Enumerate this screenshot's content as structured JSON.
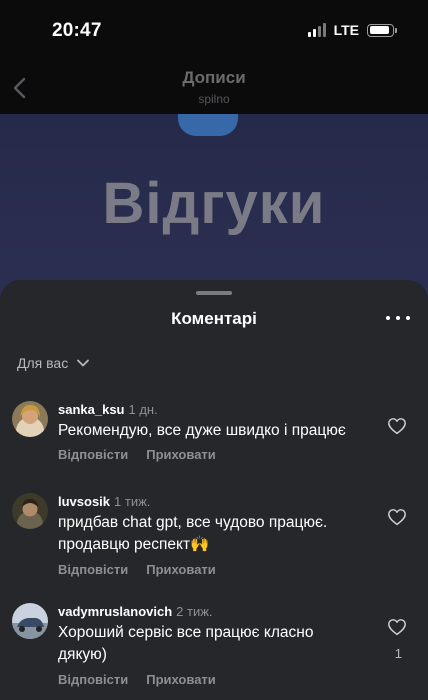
{
  "status_bar": {
    "time": "20:47",
    "network": "LTE",
    "battery_level": 0.9,
    "signal_bars": 2
  },
  "header": {
    "back_icon": "chevron-left-icon",
    "title": "Дописи",
    "subtitle": "spilno"
  },
  "post": {
    "image_text": "Відгуки"
  },
  "sheet": {
    "title": "Коментарі",
    "more_icon": "more-horizontal-icon",
    "filter_label": "Для вас",
    "filter_icon": "chevron-down-icon"
  },
  "comments": [
    {
      "username": "sanka_ksu",
      "time": "1 дн.",
      "text": "Рекомендую, все дуже швидко і працює",
      "reply": "Відповісти",
      "hide": "Приховати",
      "likes": ""
    },
    {
      "username": "luvsosik",
      "time": "1 тиж.",
      "text": "придбав chat gpt, все чудово працює. продавцю респект🙌",
      "reply": "Відповісти",
      "hide": "Приховати",
      "likes": ""
    },
    {
      "username": "vadymruslanovich",
      "time": "2 тиж.",
      "text": "Хороший сервіс все працює класно дякую)",
      "reply": "Відповісти",
      "hide": "Приховати",
      "likes": "1"
    }
  ],
  "colors": {
    "sheet_bg": "#26272b",
    "secondary_text": "#8e8e93",
    "page_bg": "#0b0b0c"
  }
}
